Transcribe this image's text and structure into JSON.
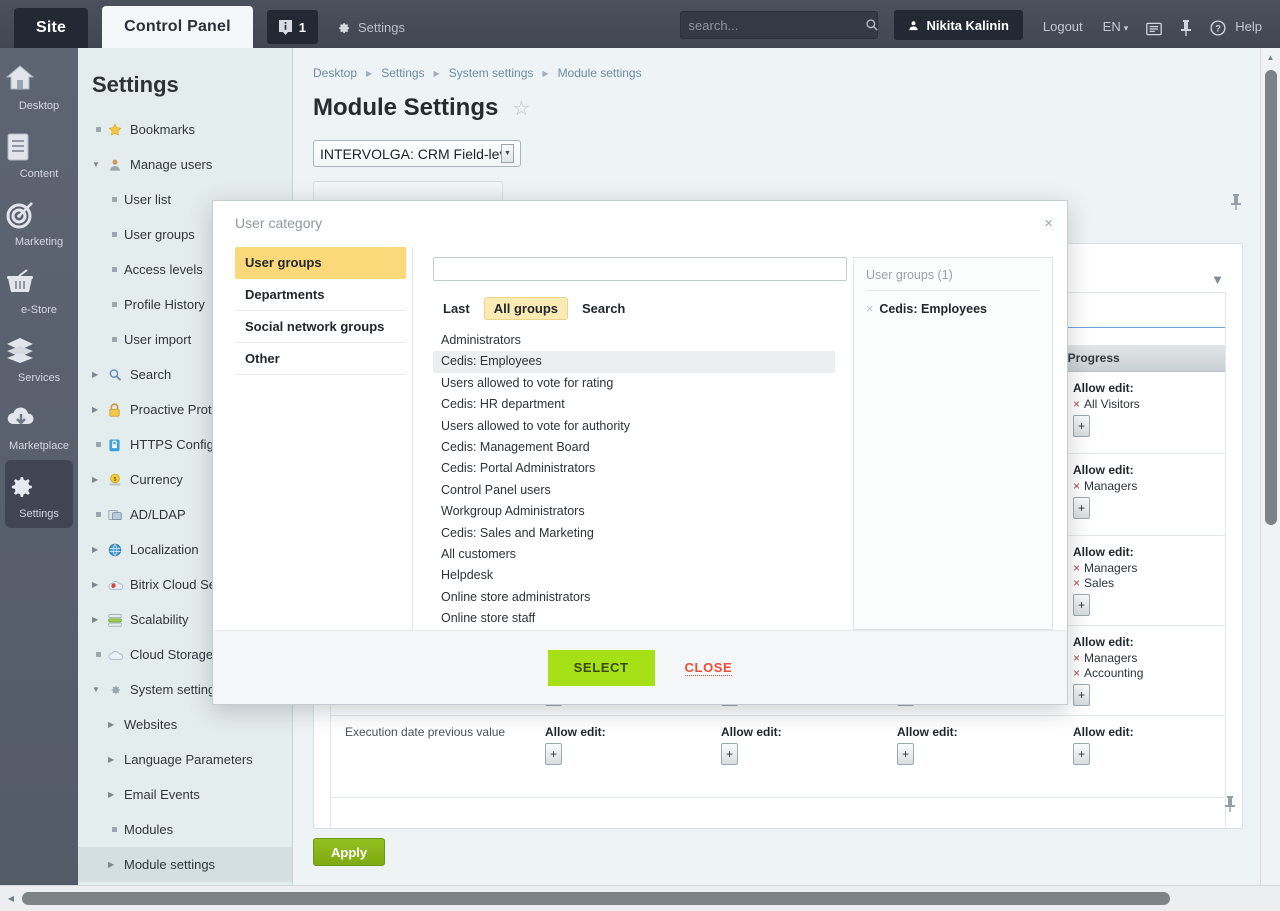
{
  "topbar": {
    "site_tab": "Site",
    "control_panel_tab": "Control Panel",
    "notification_count": "1",
    "notification_icon": "info-badge-icon",
    "settings_label": "Settings",
    "settings_icon": "gear-icon",
    "search_placeholder": "search...",
    "search_value": "",
    "search_icon": "search-icon",
    "user_name": "Nikita Kalinin",
    "user_icon": "person-icon",
    "logout_label": "Logout",
    "language_label": "EN",
    "language_caret": "▾",
    "panel_icon": "panel-icon",
    "pin_icon": "pin-icon",
    "help_icon": "question-circle-icon",
    "help_label": "Help"
  },
  "rail": {
    "items": [
      {
        "label": "Desktop",
        "icon": "house-icon",
        "active": false
      },
      {
        "label": "Content",
        "icon": "document-icon",
        "active": false
      },
      {
        "label": "Marketing",
        "icon": "target-icon",
        "active": false
      },
      {
        "label": "e-Store",
        "icon": "basket-icon",
        "active": false
      },
      {
        "label": "Services",
        "icon": "layers-icon",
        "active": false
      },
      {
        "label": "Marketplace",
        "icon": "cloud-download-icon",
        "active": false
      },
      {
        "label": "Settings",
        "icon": "gear-icon",
        "active": true
      }
    ]
  },
  "tree": {
    "title": "Settings",
    "items": [
      {
        "label": "Bookmarks",
        "marker": "square",
        "icon": "star-icon",
        "indent": 0,
        "selected": false
      },
      {
        "label": "Manage users",
        "marker": "open",
        "icon": "user-icon",
        "indent": 0,
        "selected": false
      },
      {
        "label": "User list",
        "marker": "square",
        "icon": "",
        "indent": 1,
        "selected": false
      },
      {
        "label": "User groups",
        "marker": "square",
        "icon": "",
        "indent": 1,
        "selected": false
      },
      {
        "label": "Access levels",
        "marker": "square",
        "icon": "",
        "indent": 1,
        "selected": false
      },
      {
        "label": "Profile History",
        "marker": "square",
        "icon": "",
        "indent": 1,
        "selected": false
      },
      {
        "label": "User import",
        "marker": "square",
        "icon": "",
        "indent": 1,
        "selected": false
      },
      {
        "label": "Search",
        "marker": "closed",
        "icon": "magnifier-icon",
        "indent": 0,
        "selected": false
      },
      {
        "label": "Proactive Protection",
        "marker": "closed",
        "icon": "lock-icon",
        "indent": 0,
        "selected": false
      },
      {
        "label": "HTTPS Configuration",
        "marker": "square",
        "icon": "https-lock-icon",
        "indent": 0,
        "selected": false
      },
      {
        "label": "Currency",
        "marker": "closed",
        "icon": "coin-icon",
        "indent": 0,
        "selected": false
      },
      {
        "label": "AD/LDAP",
        "marker": "square",
        "icon": "ldap-icon",
        "indent": 0,
        "selected": false
      },
      {
        "label": "Localization",
        "marker": "closed",
        "icon": "globe-icon",
        "indent": 0,
        "selected": false
      },
      {
        "label": "Bitrix Cloud Services",
        "marker": "closed",
        "icon": "cloud-red-icon",
        "indent": 0,
        "selected": false
      },
      {
        "label": "Scalability",
        "marker": "closed",
        "icon": "scalability-icon",
        "indent": 0,
        "selected": false
      },
      {
        "label": "Cloud Storage",
        "marker": "square",
        "icon": "cloud-icon",
        "indent": 0,
        "selected": false
      },
      {
        "label": "System settings",
        "marker": "open",
        "icon": "gear-icon",
        "indent": 0,
        "selected": false
      },
      {
        "label": "Websites",
        "marker": "closed",
        "icon": "",
        "indent": 1,
        "selected": false
      },
      {
        "label": "Language Parameters",
        "marker": "closed",
        "icon": "",
        "indent": 1,
        "selected": false
      },
      {
        "label": "Email Events",
        "marker": "closed",
        "icon": "",
        "indent": 1,
        "selected": false
      },
      {
        "label": "Modules",
        "marker": "square",
        "icon": "",
        "indent": 1,
        "selected": false
      },
      {
        "label": "Module settings",
        "marker": "closed",
        "icon": "",
        "indent": 1,
        "selected": true
      }
    ]
  },
  "page": {
    "breadcrumb": [
      "Desktop",
      "Settings",
      "System settings",
      "Module settings"
    ],
    "title": "Module Settings",
    "favorite_icon": "star-outline-icon",
    "module_select_value": "INTERVOLGA: CRM Field-level",
    "caret_icon": "triangle-down-icon",
    "pin_icon": "pin-icon",
    "apply_label": "Apply",
    "table": {
      "header_label": "In Progress",
      "rows": [
        {
          "field": "",
          "cells": [
            {
              "title": "Allow edit:",
              "groups": [
                "All Visitors"
              ]
            }
          ]
        },
        {
          "field": "",
          "cells": [
            {
              "title": "Allow edit:",
              "groups": [
                "Managers"
              ]
            }
          ]
        },
        {
          "field": "",
          "cells": [
            {
              "title": "Allow edit:",
              "groups": [
                "Managers",
                "Sales"
              ]
            }
          ]
        },
        {
          "field": "",
          "cells": [
            {
              "title": "Allow edit:",
              "groups": [
                "Managers",
                "Accounting"
              ]
            }
          ]
        },
        {
          "field": "Execution date previous value",
          "cells": [
            {
              "title": "Allow edit:",
              "groups": []
            }
          ]
        }
      ],
      "bottom_row_label": "Execution date previous value",
      "bottom_cell_title": "Allow edit:",
      "plus_label": "+"
    }
  },
  "modal": {
    "title": "User category",
    "close_icon": "close-icon",
    "categories": [
      {
        "label": "User groups",
        "active": true
      },
      {
        "label": "Departments",
        "active": false
      },
      {
        "label": "Social network groups",
        "active": false
      },
      {
        "label": "Other",
        "active": false
      }
    ],
    "search_value": "",
    "search_placeholder": "",
    "tabs": [
      {
        "label": "Last",
        "active": false
      },
      {
        "label": "All groups",
        "active": true
      },
      {
        "label": "Search",
        "active": false
      }
    ],
    "groups": [
      {
        "label": "Administrators",
        "selected": false
      },
      {
        "label": "Cedis: Employees",
        "selected": true
      },
      {
        "label": "Users allowed to vote for rating",
        "selected": false
      },
      {
        "label": "Cedis: HR department",
        "selected": false
      },
      {
        "label": "Users allowed to vote for authority",
        "selected": false
      },
      {
        "label": "Cedis: Management Board",
        "selected": false
      },
      {
        "label": "Cedis: Portal Administrators",
        "selected": false
      },
      {
        "label": "Control Panel users",
        "selected": false
      },
      {
        "label": "Workgroup Administrators",
        "selected": false
      },
      {
        "label": "Cedis: Sales and Marketing",
        "selected": false
      },
      {
        "label": "All customers",
        "selected": false
      },
      {
        "label": "Helpdesk",
        "selected": false
      },
      {
        "label": "Online store administrators",
        "selected": false
      },
      {
        "label": "Online store staff",
        "selected": false
      }
    ],
    "selected_panel": {
      "header": "User groups (1)",
      "items": [
        {
          "label": "Cedis: Employees",
          "remove_icon": "×"
        }
      ]
    },
    "select_label": "SELECT",
    "close_label": "CLOSE"
  },
  "scrollbars": {
    "up_arrow": "▲",
    "left_arrow": "◀"
  },
  "colors": {
    "accent_green": "#a6e016",
    "accent_yellow": "#fbd97a",
    "close_red": "#e8503a",
    "topbar_dark": "#464c57",
    "rail": "#585f6d"
  }
}
